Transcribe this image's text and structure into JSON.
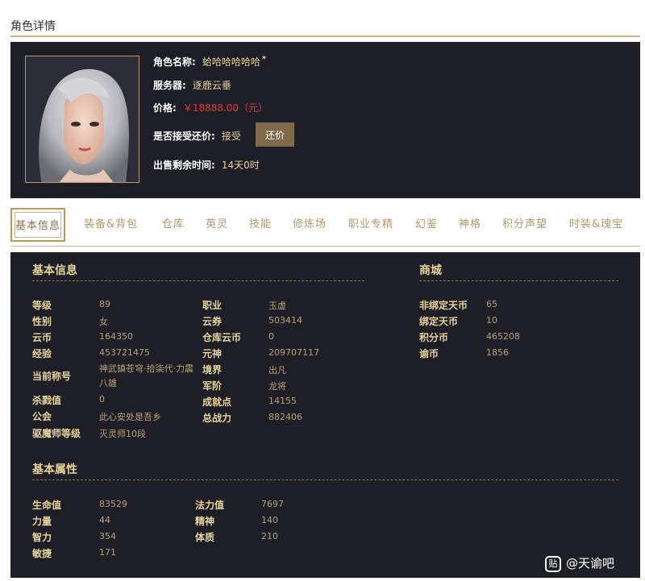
{
  "page": {
    "title": "角色详情"
  },
  "character": {
    "name_label": "角色名称:",
    "name": "蛤哈哈哈哈哈",
    "server_label": "服务器:",
    "server": "逐鹿云垂",
    "price_label": "价格:",
    "price": "￥18888.00（元）",
    "bargain_label": "是否接受还价:",
    "bargain": "接受",
    "bargain_button": "还价",
    "time_label": "出售剩余时间:",
    "time": "14天0时"
  },
  "tabs": [
    "基本信息",
    "装备&背包",
    "仓库",
    "英灵",
    "技能",
    "修炼场",
    "职业专精",
    "幻鉴",
    "神格",
    "积分声望",
    "时装&瑰宝"
  ],
  "basic_info": {
    "title": "基本信息",
    "left": [
      {
        "label": "等级",
        "value": "89"
      },
      {
        "label": "性别",
        "value": "女"
      },
      {
        "label": "云币",
        "value": "164350"
      },
      {
        "label": "经验",
        "value": "453721475"
      },
      {
        "label": "当前称号",
        "value": "神武镇苍穹·拾柒代·力震八雄"
      },
      {
        "label": "杀戮值",
        "value": "0"
      },
      {
        "label": "公会",
        "value": "此心安处是吾乡"
      },
      {
        "label": "驱魔师等级",
        "value": "灭灵师10段"
      }
    ],
    "right": [
      {
        "label": "职业",
        "value": "玉虚"
      },
      {
        "label": "云券",
        "value": "503414"
      },
      {
        "label": "仓库云币",
        "value": "0"
      },
      {
        "label": "元神",
        "value": "209707117"
      },
      {
        "label": "境界",
        "value": "出凡"
      },
      {
        "label": "军阶",
        "value": "龙将"
      },
      {
        "label": "成就点",
        "value": "14155"
      },
      {
        "label": "总战力",
        "value": "882406"
      }
    ]
  },
  "mall": {
    "title": "商城",
    "items": [
      {
        "label": "非绑定天币",
        "value": "65"
      },
      {
        "label": "绑定天币",
        "value": "10"
      },
      {
        "label": "积分币",
        "value": "465208"
      },
      {
        "label": "谕币",
        "value": "1856"
      }
    ]
  },
  "attributes": {
    "title": "基本属性",
    "left": [
      {
        "label": "生命值",
        "value": "83529"
      },
      {
        "label": "力量",
        "value": "44"
      },
      {
        "label": "智力",
        "value": "354"
      },
      {
        "label": "敏捷",
        "value": "171"
      }
    ],
    "right": [
      {
        "label": "法力值",
        "value": "7697"
      },
      {
        "label": "精神",
        "value": "140"
      },
      {
        "label": "体质",
        "value": "210"
      }
    ]
  },
  "watermark": {
    "icon": "贴",
    "text": "@天谕吧"
  }
}
